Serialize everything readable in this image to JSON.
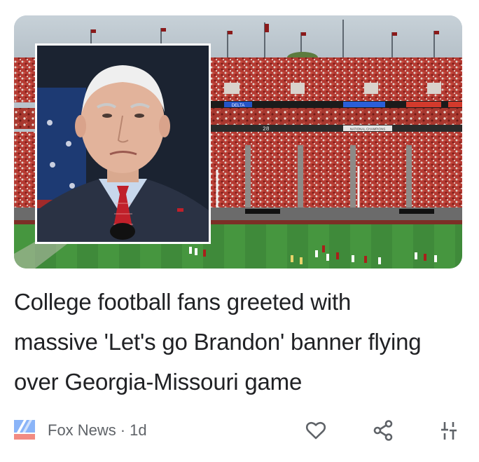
{
  "article": {
    "image_alt": "Photo of Joe Biden inset over a packed Georgia stadium during a football game",
    "headline_lines": [
      "College football fans greeted with",
      "massive 'Let's go Brandon' banner flying",
      "over Georgia-Missouri game"
    ],
    "source": {
      "name": "Fox News",
      "separator": "·",
      "age": "1d"
    },
    "stadium_signs": {
      "delta": "DELTA",
      "score": "28",
      "national_champions": "NATIONAL CHAMPIONS"
    }
  },
  "actions": {
    "like_icon": "heart-outline-icon",
    "share_icon": "share-icon",
    "more_icon": "sliders-icon"
  },
  "colors": {
    "headline_text": "#202124",
    "meta_text": "#5f6368",
    "icon": "#5f6368",
    "stadium_red": "#c0392b",
    "field_green": "#3f8a3a",
    "tie_red": "#c0202a",
    "fox_logo_blue": "#8ab4f8",
    "fox_logo_red": "#f28b82"
  }
}
